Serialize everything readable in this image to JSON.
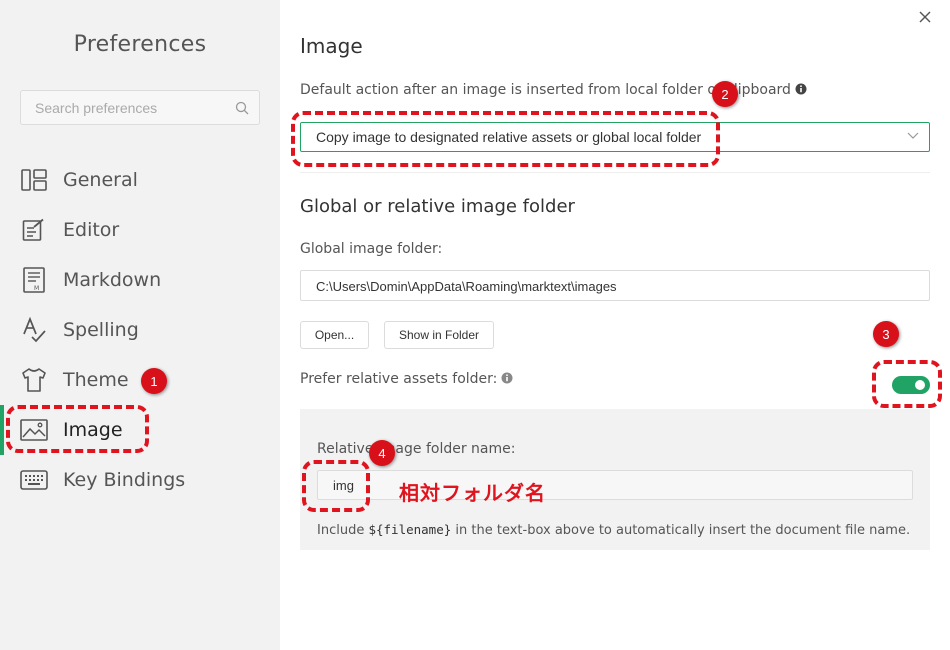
{
  "sidebar": {
    "title": "Preferences",
    "search_placeholder": "Search preferences",
    "items": [
      {
        "label": "General",
        "icon": "general-icon"
      },
      {
        "label": "Editor",
        "icon": "editor-icon"
      },
      {
        "label": "Markdown",
        "icon": "markdown-icon"
      },
      {
        "label": "Spelling",
        "icon": "spelling-icon"
      },
      {
        "label": "Theme",
        "icon": "theme-icon"
      },
      {
        "label": "Image",
        "icon": "image-icon",
        "active": true
      },
      {
        "label": "Key Bindings",
        "icon": "keyboard-icon"
      }
    ]
  },
  "main": {
    "title": "Image",
    "default_action": {
      "label": "Default action after an image is inserted from local folder or clipboard",
      "selected": "Copy image to designated relative assets or global local folder"
    },
    "folder_section": {
      "title": "Global or relative image folder",
      "global_label": "Global image folder:",
      "global_path": "C:\\Users\\Domin\\AppData\\Roaming\\marktext\\images",
      "open_button": "Open...",
      "show_button": "Show in Folder",
      "prefer_relative_label": "Prefer relative assets folder:",
      "prefer_relative_enabled": true,
      "relative_name_label": "Relative image folder name:",
      "relative_name_value": "img",
      "hint_prefix": "Include ",
      "hint_code": "${filename}",
      "hint_suffix": " in the text-box above to automatically insert the document file name."
    }
  },
  "annotations": {
    "badges": [
      "1",
      "2",
      "3",
      "4"
    ],
    "jp_label": "相対フォルダ名",
    "color": "#e0141e"
  },
  "colors": {
    "accent": "#21a366",
    "sidebar_bg": "#f2f2f2"
  }
}
